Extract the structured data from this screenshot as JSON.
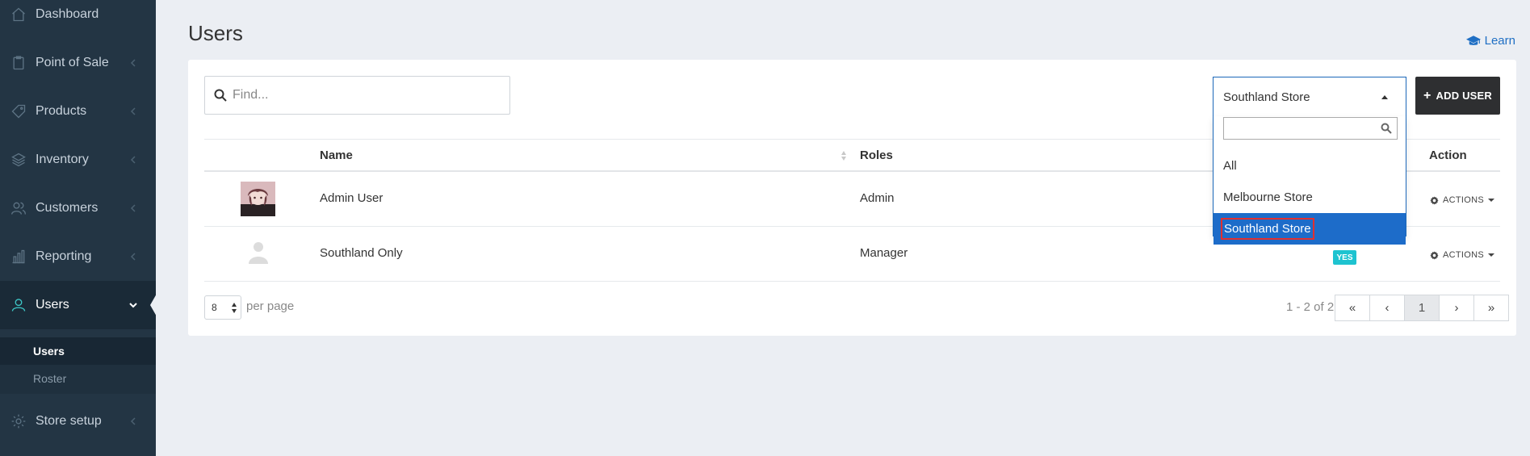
{
  "sidebar": {
    "items": [
      {
        "label": "Dashboard"
      },
      {
        "label": "Point of Sale"
      },
      {
        "label": "Products"
      },
      {
        "label": "Inventory"
      },
      {
        "label": "Customers"
      },
      {
        "label": "Reporting"
      },
      {
        "label": "Users"
      },
      {
        "label": "Store setup"
      }
    ],
    "sub_items": [
      {
        "label": "Users"
      },
      {
        "label": "Roster"
      }
    ]
  },
  "header": {
    "title": "Users",
    "learn_label": "Learn"
  },
  "toolbar": {
    "search_placeholder": "Find...",
    "store_selected": "Southland Store",
    "add_user_label": "ADD USER"
  },
  "store_dropdown": {
    "options": [
      "All",
      "Melbourne Store",
      "Southland Store"
    ],
    "selected": "Southland Store"
  },
  "table": {
    "columns": [
      "Name",
      "Roles",
      "Action"
    ],
    "rows": [
      {
        "name": "Admin User",
        "role": "Admin",
        "badge": "",
        "actions_label": "ACTIONS"
      },
      {
        "name": "Southland Only",
        "role": "Manager",
        "badge": "YES",
        "actions_label": "ACTIONS"
      }
    ]
  },
  "pagination": {
    "per_page_value": "8",
    "per_page_label": "per page",
    "range_text": "1 - 2 of 2",
    "first": "«",
    "prev": "‹",
    "current": "1",
    "next": "›",
    "last": "»"
  },
  "colors": {
    "sidebar_bg": "#233544",
    "accent_teal": "#3ec7c7",
    "link_blue": "#1f6fc4",
    "selected_option": "#1d6cc9",
    "badge": "#1ec3d0"
  }
}
